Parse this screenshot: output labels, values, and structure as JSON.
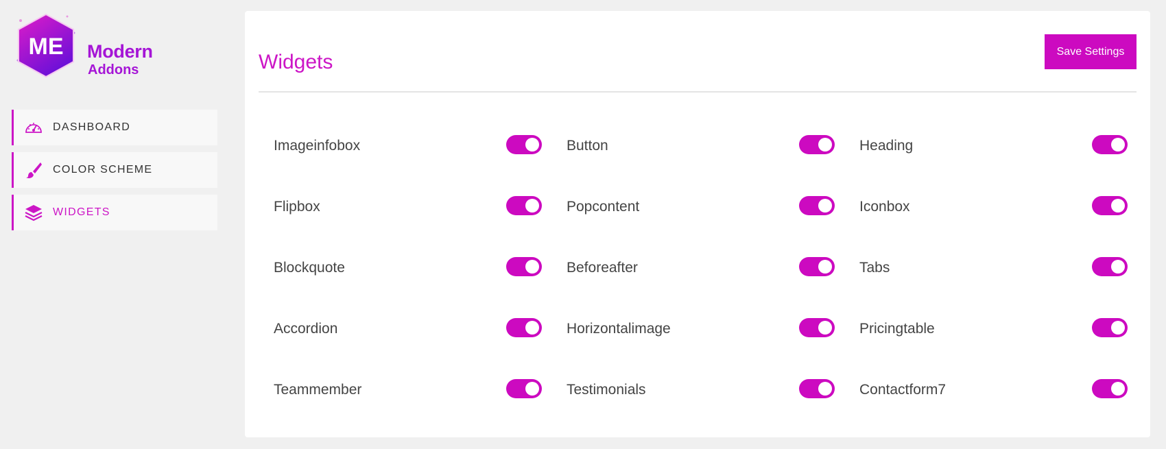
{
  "brand": {
    "logo_letters": "ME",
    "name_line1": "Modern",
    "name_line2": "Addons"
  },
  "sidebar": {
    "items": [
      {
        "label": "DASHBOARD",
        "icon": "dashboard-gauge-icon",
        "active": false
      },
      {
        "label": "COLOR SCHEME",
        "icon": "paint-brush-icon",
        "active": false
      },
      {
        "label": "WIDGETS",
        "icon": "layers-icon",
        "active": true
      }
    ]
  },
  "main": {
    "title": "Widgets",
    "save_label": "Save Settings",
    "widgets": [
      {
        "label": "Imageinfobox",
        "enabled": true
      },
      {
        "label": "Button",
        "enabled": true
      },
      {
        "label": "Heading",
        "enabled": true
      },
      {
        "label": "Flipbox",
        "enabled": true
      },
      {
        "label": "Popcontent",
        "enabled": true
      },
      {
        "label": "Iconbox",
        "enabled": true
      },
      {
        "label": "Blockquote",
        "enabled": true
      },
      {
        "label": "Beforeafter",
        "enabled": true
      },
      {
        "label": "Tabs",
        "enabled": true
      },
      {
        "label": "Accordion",
        "enabled": true
      },
      {
        "label": "Horizontalimage",
        "enabled": true
      },
      {
        "label": "Pricingtable",
        "enabled": true
      },
      {
        "label": "Teammember",
        "enabled": true
      },
      {
        "label": "Testimonials",
        "enabled": true
      },
      {
        "label": "Contactform7",
        "enabled": true
      }
    ]
  },
  "colors": {
    "accent": "#cc0ac0",
    "brand_purple": "#a515d6",
    "background": "#f0f0f0"
  }
}
